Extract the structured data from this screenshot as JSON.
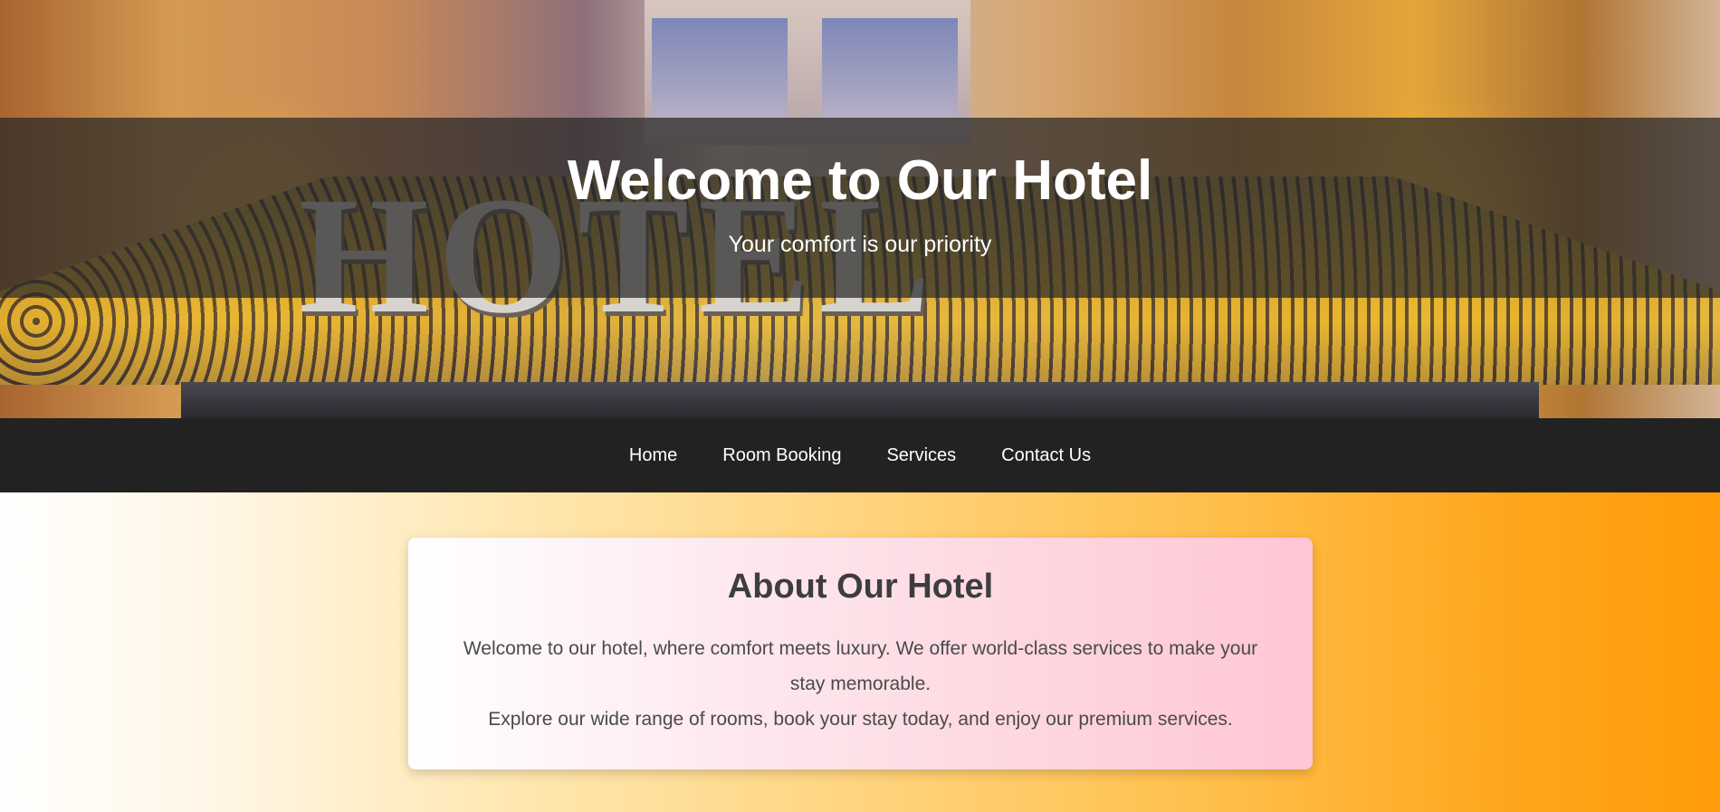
{
  "hero": {
    "title": "Welcome to Our Hotel",
    "subtitle": "Your comfort is our priority",
    "background_image": "hotel-facade-with-HOTEL-sign",
    "sign_text": "HOTEL"
  },
  "nav": {
    "items": [
      {
        "label": "Home"
      },
      {
        "label": "Room Booking"
      },
      {
        "label": "Services"
      },
      {
        "label": "Contact Us"
      }
    ]
  },
  "about": {
    "title": "About Our Hotel",
    "paragraph_1": "Welcome to our hotel, where comfort meets luxury. We offer world-class services to make your stay memorable.",
    "paragraph_2": "Explore our wide range of rooms, book your stay today, and enjoy our premium services."
  },
  "colors": {
    "nav_background": "#222222",
    "hero_overlay": "rgba(40,40,40,0.72)",
    "page_gradient_start": "#ffffff",
    "page_gradient_end": "#ff9c08",
    "card_gradient_end": "#ffc6d3",
    "heading_text": "#3d3d3d"
  }
}
